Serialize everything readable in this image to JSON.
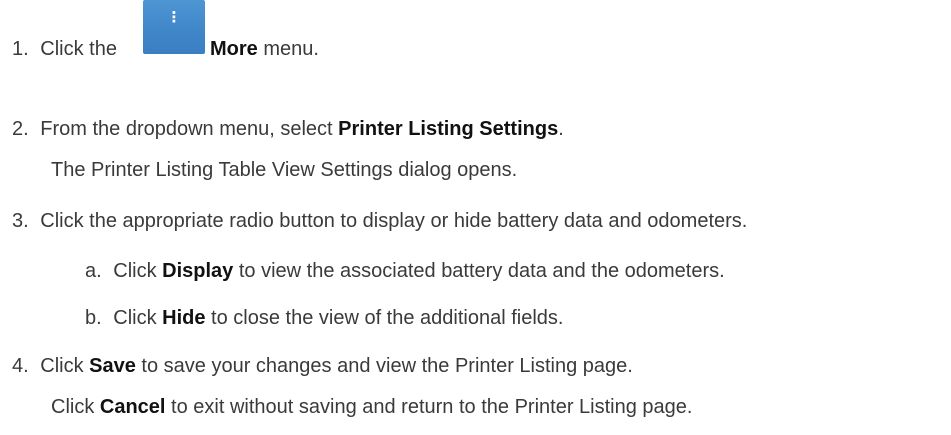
{
  "steps": {
    "s1": {
      "num": "1.",
      "pre": "Click the",
      "kw": "More",
      "post": " menu.",
      "icon": "more-vertical-dots-icon",
      "icon_color": "#4289cc"
    },
    "s2": {
      "num": "2.",
      "pre": "From the dropdown menu, select ",
      "kw": "Printer Listing Settings",
      "post": "."
    },
    "s2_note": "The Printer Listing Table View Settings dialog opens.",
    "s3": {
      "num": "3.",
      "text": "Click the appropriate radio button to display or hide battery data and odometers."
    },
    "s3a": {
      "num": "a.",
      "pre": "Click ",
      "kw": "Display",
      "post": " to view the associated battery data and the odometers."
    },
    "s3b": {
      "num": "b.",
      "pre": "Click ",
      "kw": "Hide",
      "post": " to close the view of the additional fields."
    },
    "s4": {
      "num": "4.",
      "pre": "Click ",
      "kw": "Save",
      "post": " to save your changes and view the Printer Listing page."
    },
    "s4_note": {
      "pre": "Click ",
      "kw": "Cancel",
      "post": " to exit without saving and return to the Printer Listing page."
    }
  }
}
